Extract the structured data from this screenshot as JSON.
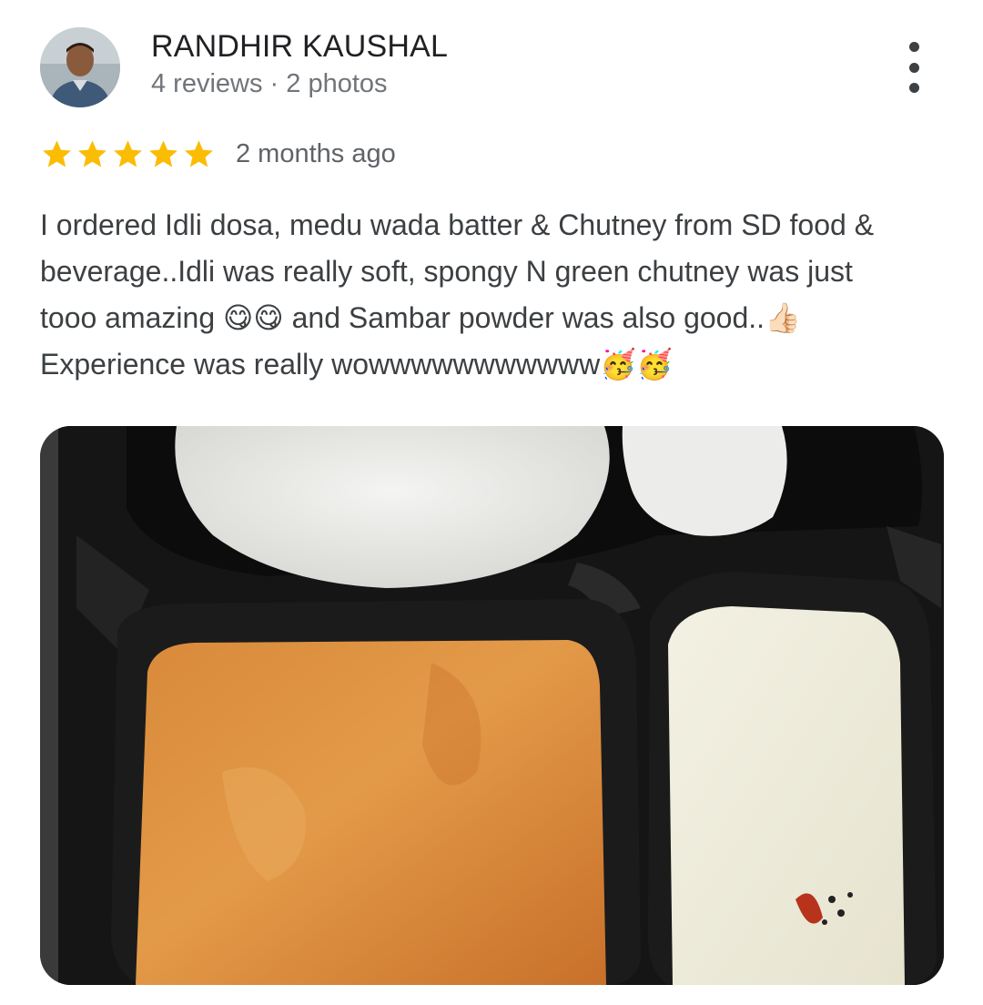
{
  "review": {
    "author": {
      "name": "RANDHIR KAUSHAL",
      "meta": "4 reviews · 2 photos",
      "avatar_icon": "person-avatar"
    },
    "rating": 5,
    "max_rating": 5,
    "date": "2 months ago",
    "text_lines": [
      "I ordered Idli dosa, medu wada batter & Chutney from SD food &",
      "beverage..Idli was really soft, spongy N green chutney was just",
      "tooo amazing 😋😋 and Sambar powder was also good..👍🏻",
      "Experience was really wowwwwwwwwwww🥳🥳"
    ],
    "photo_icon": "food-photo",
    "more_icon": "more-vertical-icon",
    "star_color": "#fbbc04"
  }
}
